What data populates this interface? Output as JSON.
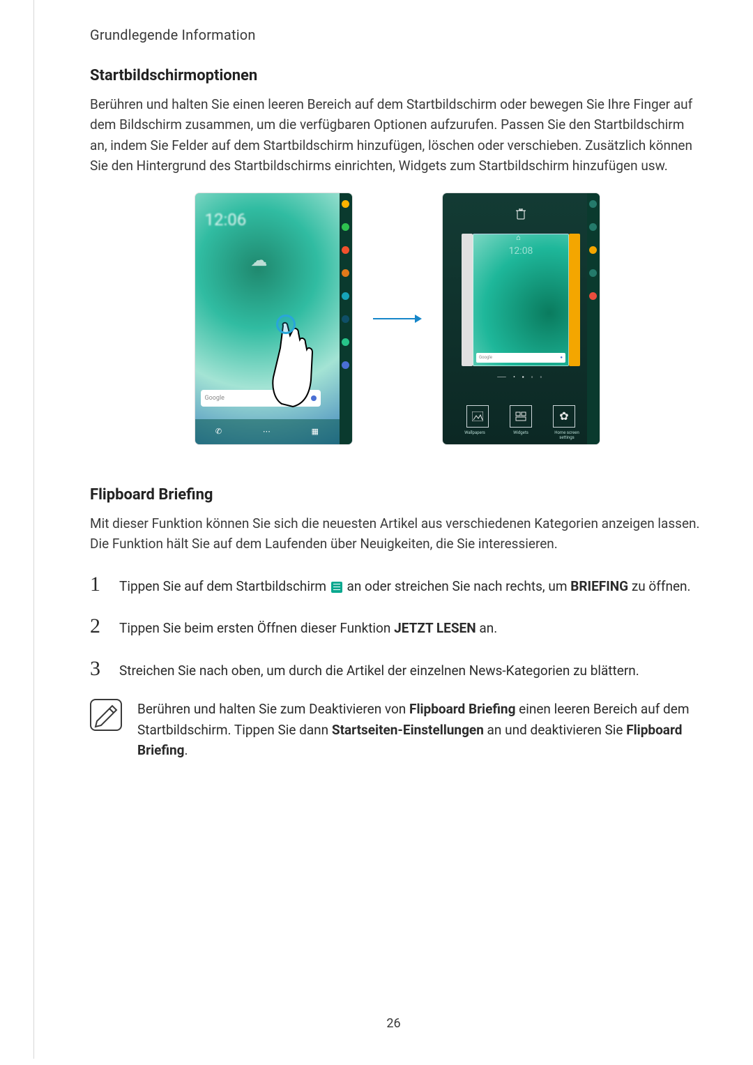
{
  "header": {
    "section": "Grundlegende Information"
  },
  "s1": {
    "heading": "Startbildschirmoptionen",
    "para": "Berühren und halten Sie einen leeren Bereich auf dem Startbildschirm oder bewegen Sie Ihre Finger auf dem Bildschirm zusammen, um die verfügbaren Optionen aufzurufen. Passen Sie den Startbildschirm an, indem Sie Felder auf dem Startbildschirm hinzufügen, löschen oder verschieben. Zusätzlich können Sie den Hintergrund des Startbildschirms einrichten, Widgets zum Startbildschirm hinzufügen usw."
  },
  "fig": {
    "left": {
      "time": "12:06",
      "search_label": "Google",
      "edge_colors": [
        "#ffb400",
        "#2ec24f",
        "#f1512d",
        "#e07a1a",
        "#17a3b7",
        "#0f4f68",
        "#27c489",
        "#4a6fd4"
      ]
    },
    "right": {
      "time": "12:08",
      "buttons": [
        "Wallpapers",
        "Widgets",
        "Home screen settings"
      ],
      "search_label": "Google"
    }
  },
  "s2": {
    "heading": "Flipboard Briefing",
    "para": "Mit dieser Funktion können Sie sich die neuesten Artikel aus verschiedenen Kategorien anzeigen lassen. Die Funktion hält Sie auf dem Laufenden über Neuigkeiten, die Sie interessieren.",
    "steps": [
      {
        "num": "1",
        "pre": "Tippen Sie auf dem Startbildschirm ",
        "post": " an oder streichen Sie nach rechts, um ",
        "bold1": "BRIEFING",
        "after1": " zu öffnen."
      },
      {
        "num": "2",
        "pre": "Tippen Sie beim ersten Öffnen dieser Funktion ",
        "bold1": "JETZT LESEN",
        "after1": " an."
      },
      {
        "num": "3",
        "pre": "Streichen Sie nach oben, um durch die Artikel der einzelnen News-Kategorien zu blättern."
      }
    ],
    "note": {
      "t1": "Berühren und halten Sie zum Deaktivieren von ",
      "b1": "Flipboard Briefing",
      "t2": " einen leeren Bereich auf dem Startbildschirm. Tippen Sie dann ",
      "b2": "Startseiten-Einstellungen",
      "t3": " an und deaktivieren Sie ",
      "b3": "Flipboard Briefing",
      "t4": "."
    }
  },
  "page_number": "26"
}
